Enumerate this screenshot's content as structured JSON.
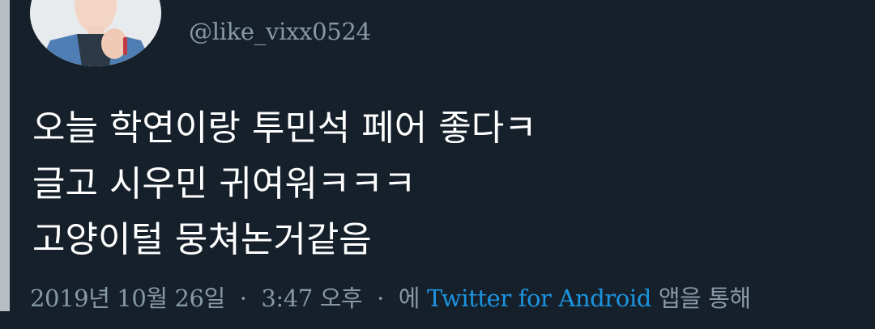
{
  "tweet": {
    "handle": "@like_vixx0524",
    "lines": [
      "오늘 학연이랑 투민석 페어 좋다ㅋ",
      "글고 시우민 귀여워ㅋㅋㅋ",
      "고양이털 뭉쳐논거같음"
    ]
  },
  "meta": {
    "date": "2019년 10월 26일",
    "separator": "·",
    "time": "3:47 오후",
    "via_prefix": "에",
    "source": "Twitter for Android",
    "via_suffix": "앱을 통해"
  },
  "colors": {
    "background": "#15202b",
    "text": "#ffffff",
    "secondary_text": "#8899a6",
    "link": "#1b95e0"
  },
  "icons": {
    "avatar": "profile-photo"
  }
}
